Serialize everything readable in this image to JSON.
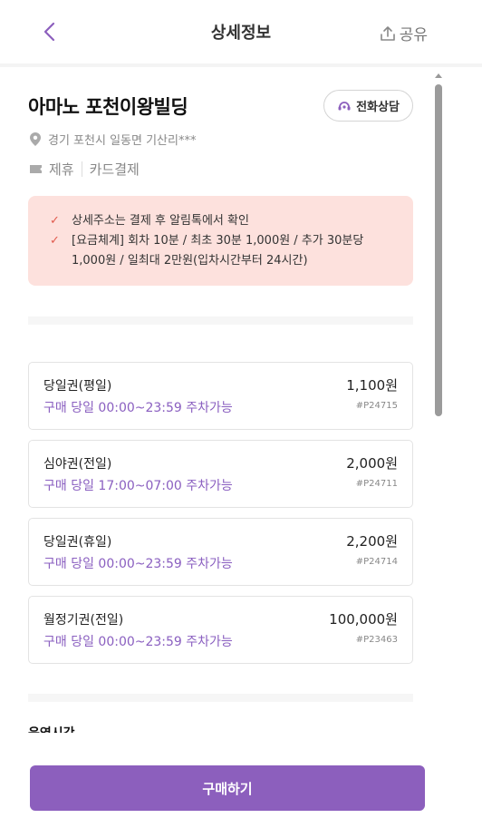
{
  "header": {
    "title": "상세정보",
    "share_label": "공유"
  },
  "place": {
    "name": "아마노 포천이왕빌딩",
    "call_label": "전화상담",
    "address": "경기 포천시 일동면 기산리***",
    "tags": [
      "제휴",
      "카드결제"
    ]
  },
  "notice": {
    "items": [
      "상세주소는 결제 후 알림톡에서 확인",
      "[요금체계] 회차 10분 / 최초 30분 1,000원 / 추가 30분당 1,000원 / 일최대 2만원(입차시간부터 24시간)"
    ]
  },
  "tickets": [
    {
      "name": "당일권(평일)",
      "price": "1,100원",
      "time": "구매 당일 00:00~23:59 주차가능",
      "code": "#P24715"
    },
    {
      "name": "심야권(전일)",
      "price": "2,000원",
      "time": "구매 당일 17:00~07:00 주차가능",
      "code": "#P24711"
    },
    {
      "name": "당일권(휴일)",
      "price": "2,200원",
      "time": "구매 당일 00:00~23:59 주차가능",
      "code": "#P24714"
    },
    {
      "name": "월정기권(전일)",
      "price": "100,000원",
      "time": "구매 당일 00:00~23:59 주차가능",
      "code": "#P23463"
    }
  ],
  "next_section_title": "운영시간",
  "buy_button_label": "구매하기",
  "colors": {
    "accent": "#8c5fbd",
    "notice_bg": "#fde1dd",
    "check": "#e15b4e"
  }
}
